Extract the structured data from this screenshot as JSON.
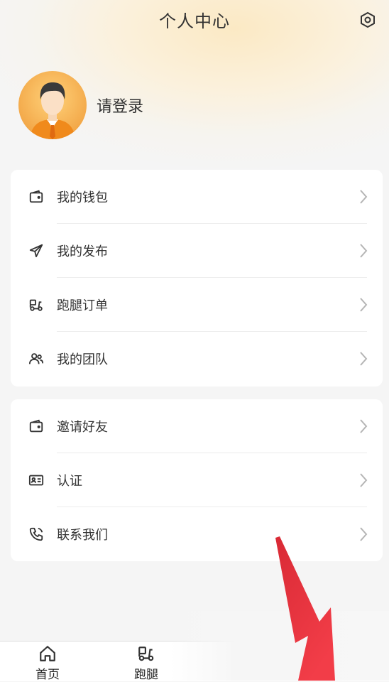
{
  "header": {
    "title": "个人中心",
    "settings_icon": "settings-hexagon-icon"
  },
  "profile": {
    "login_label": "请登录",
    "avatar_icon": "user-avatar-icon"
  },
  "menu_group_1": {
    "items": [
      {
        "label": "我的钱包",
        "icon": "wallet-icon"
      },
      {
        "label": "我的发布",
        "icon": "send-icon"
      },
      {
        "label": "跑腿订单",
        "icon": "scooter-icon"
      },
      {
        "label": "我的团队",
        "icon": "team-icon"
      }
    ]
  },
  "menu_group_2": {
    "items": [
      {
        "label": "邀请好友",
        "icon": "wallet-icon"
      },
      {
        "label": "认证",
        "icon": "id-card-icon"
      },
      {
        "label": "联系我们",
        "icon": "phone-icon"
      }
    ]
  },
  "tabbar": {
    "tabs": [
      {
        "label": "首页",
        "icon": "home-icon"
      },
      {
        "label": "跑腿",
        "icon": "scooter-icon"
      }
    ]
  },
  "colors": {
    "accent": "#f3a94a",
    "arrow": "#e8303a",
    "text": "#333333"
  }
}
